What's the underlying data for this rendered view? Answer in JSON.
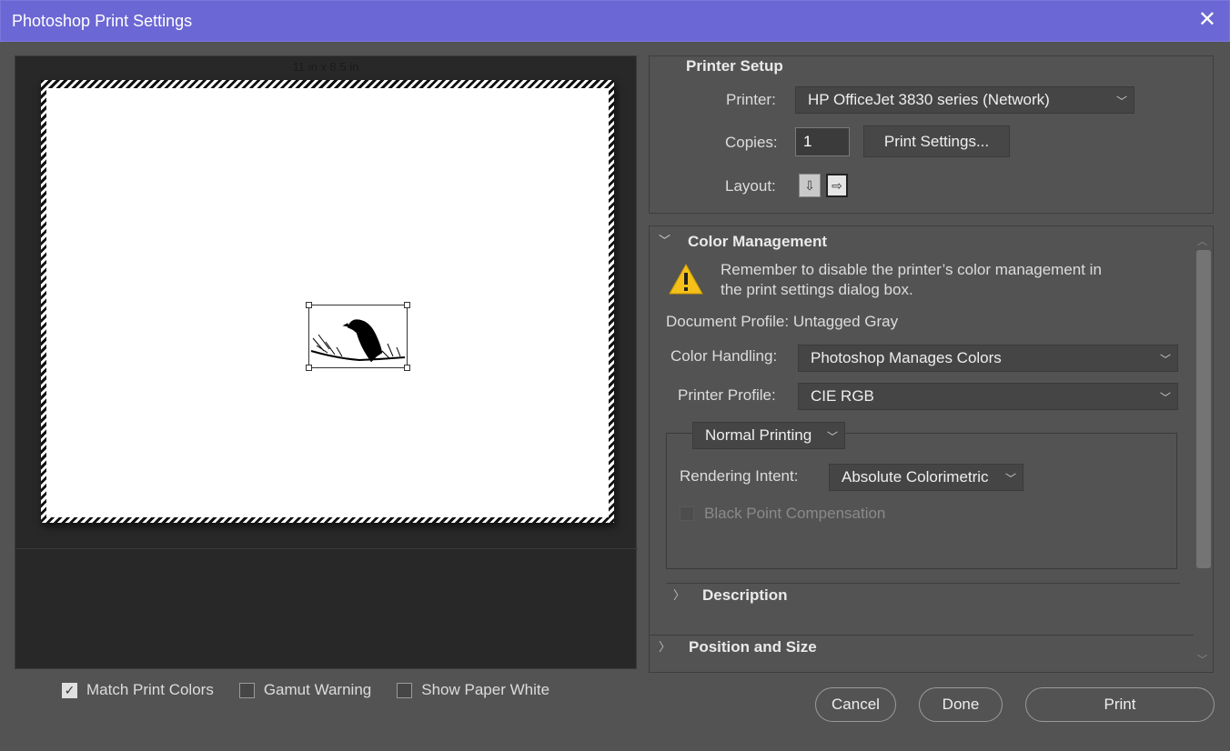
{
  "window": {
    "title": "Photoshop Print Settings",
    "close_glyph": "✕"
  },
  "preview": {
    "paper_size": "11 in  x 8.5 in",
    "checkboxes": [
      {
        "label": "Match Print Colors",
        "checked": true
      },
      {
        "label": "Gamut Warning",
        "checked": false
      },
      {
        "label": "Show Paper White",
        "checked": false
      }
    ]
  },
  "printer_setup": {
    "title": "Printer Setup",
    "printer_label": "Printer:",
    "printer_value": "HP OfficeJet 3830 series (Network)",
    "copies_label": "Copies:",
    "copies_value": "1",
    "print_settings_button": "Print Settings...",
    "layout_label": "Layout:",
    "layout_icons": [
      "portrait-layout-icon",
      "landscape-layout-icon"
    ]
  },
  "color_management": {
    "title": "Color Management",
    "warning": "Remember to disable the printer’s color management in the print settings dialog box.",
    "document_profile": "Document Profile: Untagged Gray",
    "color_handling_label": "Color Handling:",
    "color_handling_value": "Photoshop Manages Colors",
    "printer_profile_label": "Printer Profile:",
    "printer_profile_value": "CIE RGB",
    "normal_printing_value": "Normal Printing",
    "rendering_intent_label": "Rendering Intent:",
    "rendering_intent_value": "Absolute Colorimetric",
    "black_point_label": "Black Point Compensation"
  },
  "sections": {
    "description": "Description",
    "position_size": "Position and Size"
  },
  "buttons": {
    "cancel": "Cancel",
    "done": "Done",
    "print": "Print"
  },
  "colors": {
    "titlebar": "#6b67d4",
    "panel": "#535353",
    "warning": "#f5c01a"
  }
}
